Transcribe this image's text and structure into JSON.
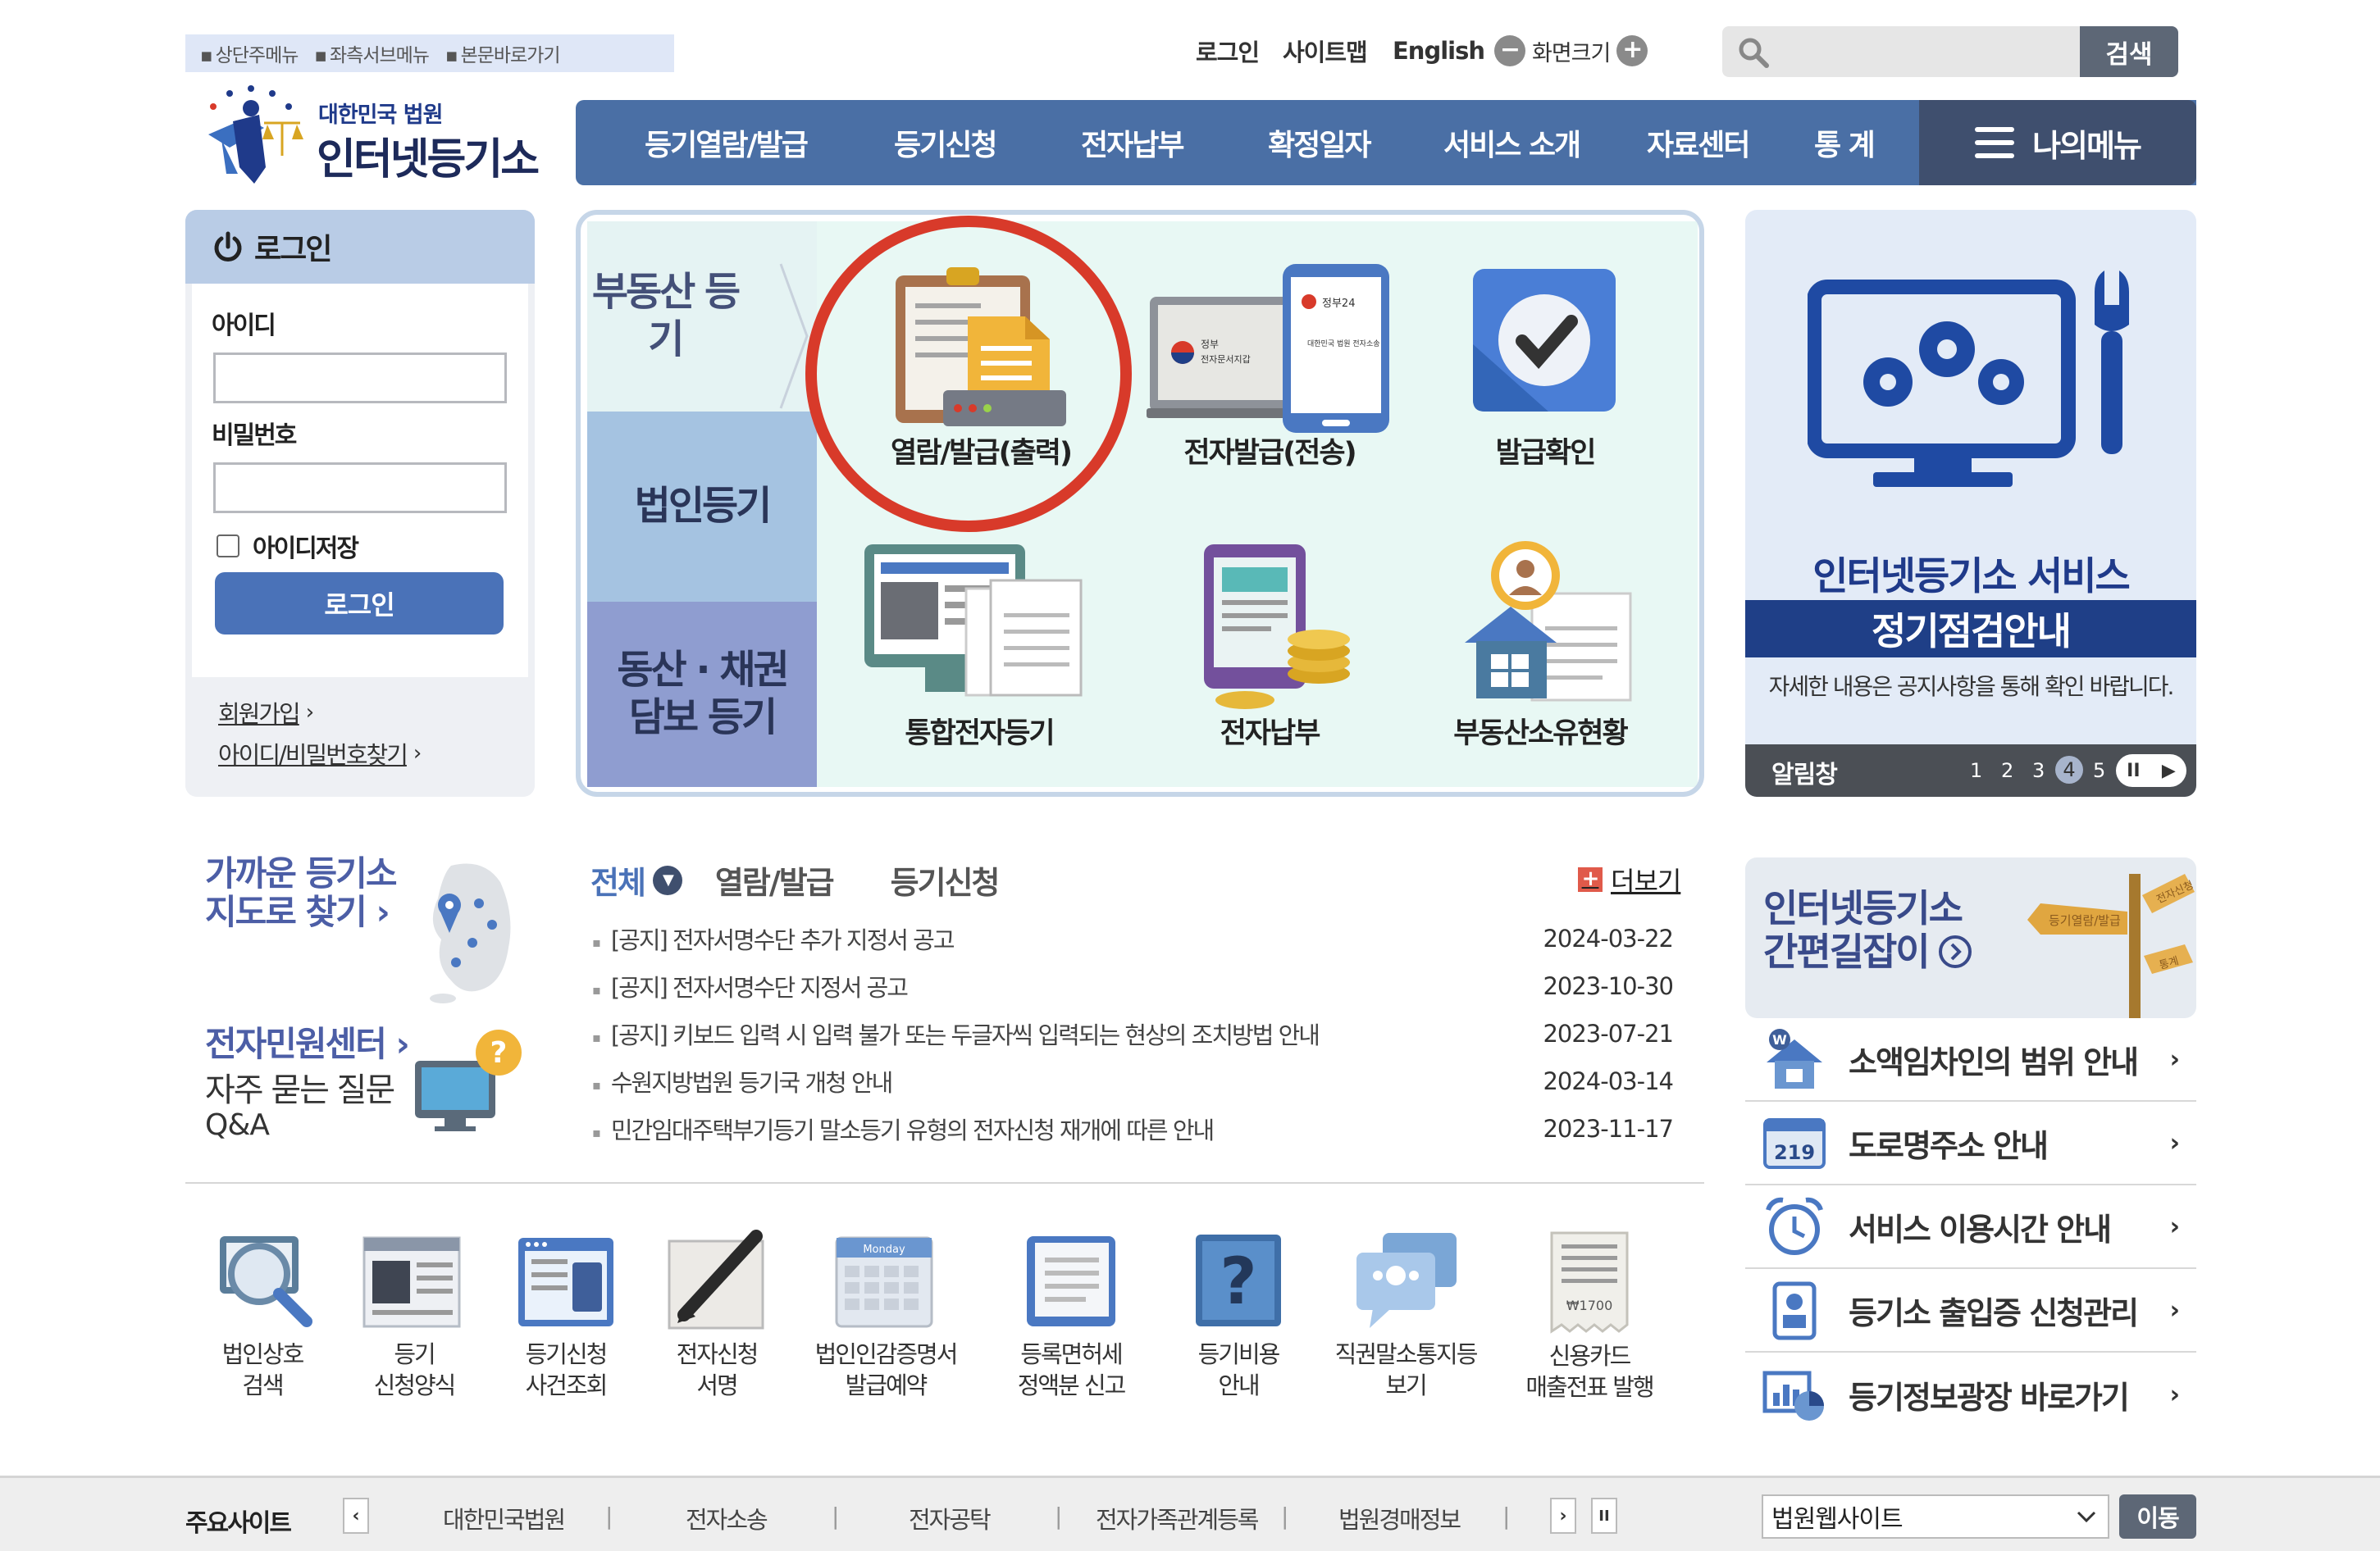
{
  "skip_links": [
    "상단주메뉴",
    "좌측서브메뉴",
    "본문바로가기"
  ],
  "util": {
    "login": "로그인",
    "sitemap": "사이트맵",
    "english": "English",
    "zoom_label": "화면크기",
    "zoom_out": "−",
    "zoom_in": "+"
  },
  "search": {
    "placeholder": "",
    "button": "검색"
  },
  "logo": {
    "small": "대한민국 법원",
    "big": "인터넷등기소"
  },
  "nav": {
    "items": [
      "등기열람/발급",
      "등기신청",
      "전자납부",
      "확정일자",
      "서비스 소개",
      "자료센터",
      "통 계"
    ],
    "my_menu": "나의메뉴"
  },
  "login": {
    "title": "로그인",
    "id_label": "아이디",
    "pw_label": "비밀번호",
    "save_id": "아이디저장",
    "button": "로그인",
    "join": "회원가입",
    "find": "아이디/비밀번호찾기",
    "arrow": "›"
  },
  "center": {
    "side": {
      "real_estate": "부동산 등기",
      "corporate": "법인등기",
      "movable": "동산 · 채권 담보 등기"
    },
    "services": [
      "열람/발급(출력)",
      "전자발급(전송)",
      "발급확인",
      "통합전자등기",
      "전자납부",
      "부동산소유현황"
    ],
    "doc_text": {
      "line1": "정부",
      "line2": "전자문서지갑",
      "phone1": "정부24",
      "phone2": "대한민국 법원 전자소송"
    }
  },
  "banner": {
    "title1": "인터넷등기소 서비스",
    "title2": "정기점검안내",
    "desc": "자세한 내용은 공지사항을 통해 확인 바랍니다.",
    "bar_label": "알림창",
    "pages": [
      "1",
      "2",
      "3",
      "4",
      "5"
    ],
    "active_page": "4",
    "pause": "II",
    "next": "▶"
  },
  "quick": {
    "nearby1": "가까운 등기소",
    "nearby2": "지도로 찾기 ›",
    "center": "전자민원센터 ›",
    "faq": "자주 묻는 질문",
    "qa": "Q&A",
    "q_mark": "?"
  },
  "notice": {
    "tabs": [
      "전체",
      "열람/발급",
      "등기신청"
    ],
    "more": "더보기",
    "more_icon": "+",
    "rows": [
      {
        "title": "[공지] 전자서명수단 추가 지정서 공고",
        "date": "2024-03-22"
      },
      {
        "title": "[공지] 전자서명수단 지정서 공고",
        "date": "2023-10-30"
      },
      {
        "title": "[공지] 키보드 입력 시 입력 불가 또는 두글자씩 입력되는 현상의 조치방법 안내",
        "date": "2023-07-21"
      },
      {
        "title": "수원지방법원 등기국 개청 안내",
        "date": "2024-03-14"
      },
      {
        "title": "민간임대주택부기등기 말소등기 유형의 전자신청 재개에 따른 안내",
        "date": "2023-11-17"
      }
    ]
  },
  "quick_icons": [
    {
      "l1": "법인상호",
      "l2": "검색"
    },
    {
      "l1": "등기",
      "l2": "신청양식"
    },
    {
      "l1": "등기신청",
      "l2": "사건조회"
    },
    {
      "l1": "전자신청",
      "l2": "서명"
    },
    {
      "l1": "법인인감증명서",
      "l2": "발급예약"
    },
    {
      "l1": "등록면허세",
      "l2": "정액분 신고"
    },
    {
      "l1": "등기비용",
      "l2": "안내"
    },
    {
      "l1": "직권말소통지등",
      "l2": "보기"
    },
    {
      "l1": "신용카드",
      "l2": "매출전표 발행"
    }
  ],
  "icon_text": {
    "calendar": "Monday",
    "receipt": "₩1700",
    "question": "?"
  },
  "guide": {
    "title1": "인터넷등기소",
    "title2": "간편길잡이",
    "sign1": "전자신청",
    "sign2": "등기열람/발급",
    "sign3": "통계"
  },
  "right_list": [
    "소액임차인의 범위 안내",
    "도로명주소 안내",
    "서비스 이용시간 안내",
    "등기소 출입증 신청관리",
    "등기정보광장 바로가기"
  ],
  "right_list_badge": "219",
  "right_list_arrow": "›",
  "footer": {
    "label": "주요사이트",
    "sites": [
      "대한민국법원",
      "전자소송",
      "전자공탁",
      "전자가족관계등록",
      "법원경매정보"
    ],
    "select": "법원웹사이트",
    "go": "이동",
    "prev": "‹",
    "next": "›",
    "pause": "II"
  },
  "colors": {
    "nav": "#4a6fa5",
    "mymenu": "#3f4f6e",
    "accent_red": "#d83a2a",
    "banner_navy": "#1f3f87"
  }
}
